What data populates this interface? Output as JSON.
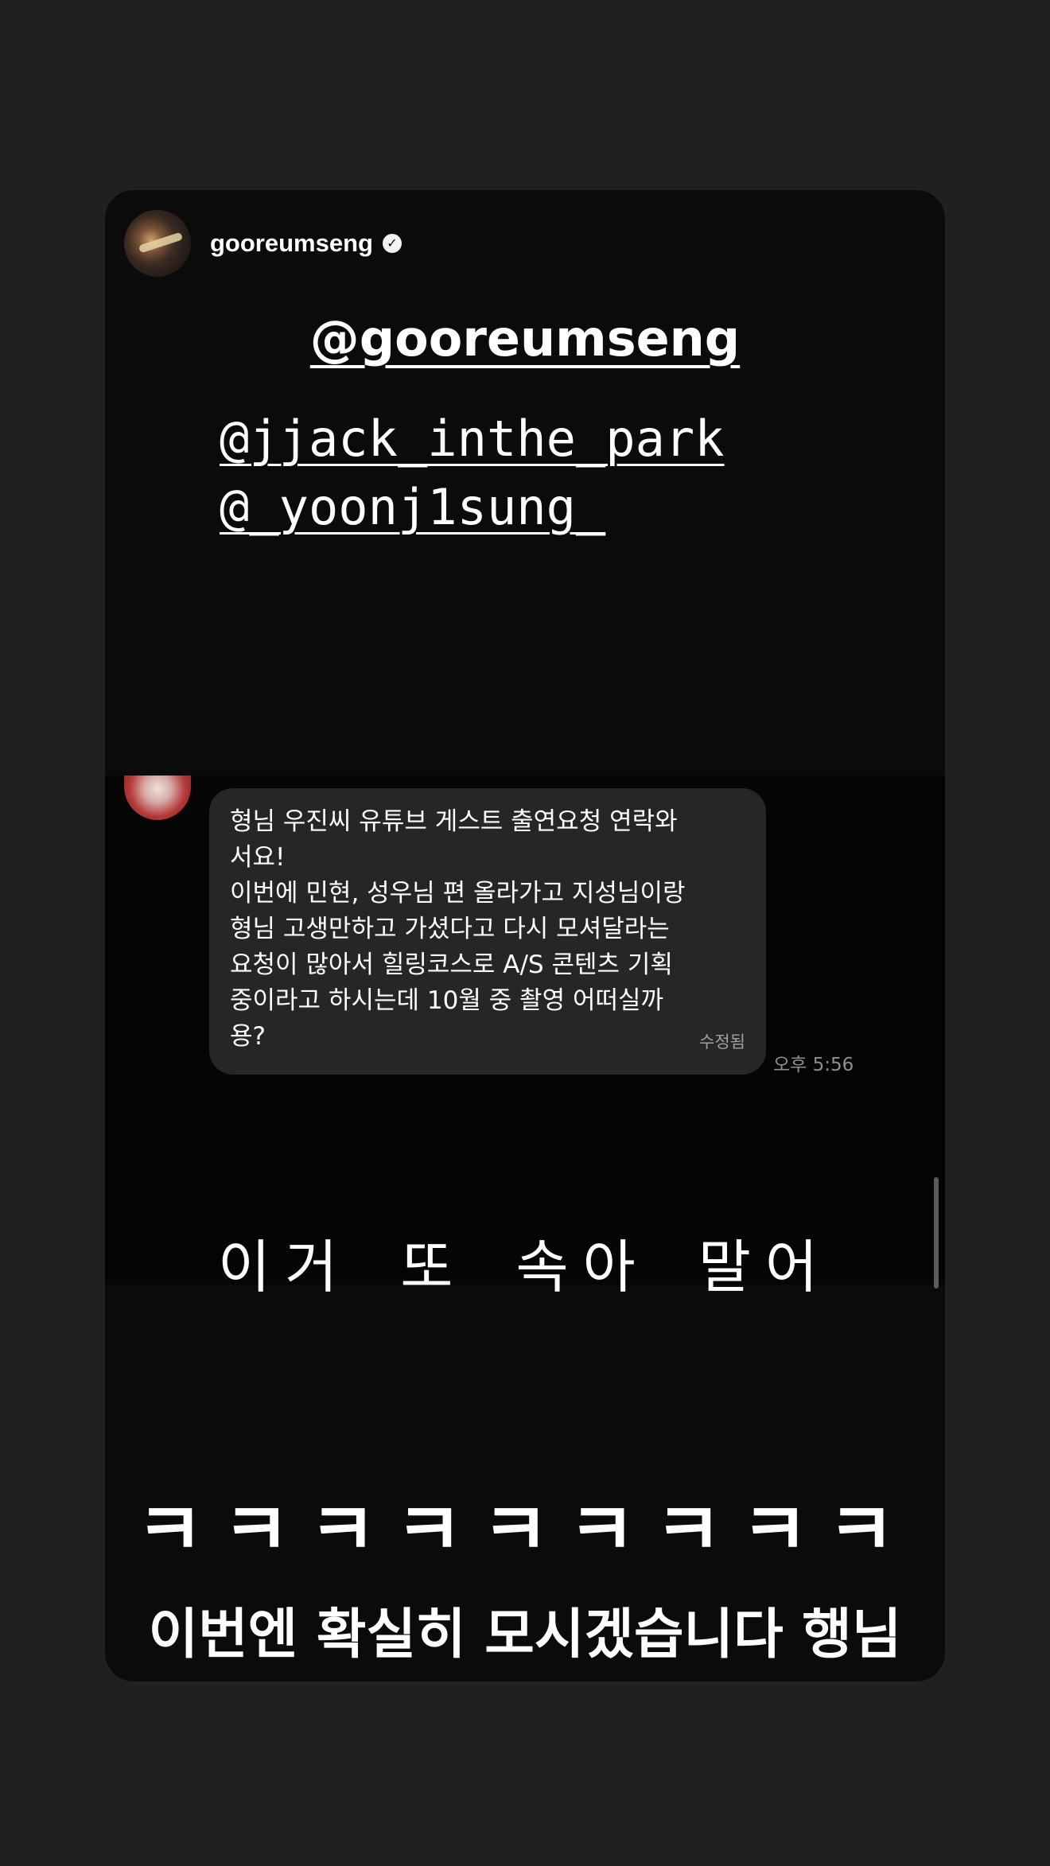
{
  "story": {
    "username": "gooreumseng",
    "verified": true
  },
  "mentions": {
    "main": "@gooreumseng",
    "secondary": [
      "@jjack_inthe_park",
      "@_yoonj1sung_"
    ]
  },
  "dm": {
    "message": "형님 우진씨 유튜브 게스트 출연요청 연락와\n서요!\n이번에 민현, 성우님 편 올라가고 지성님이랑\n형님 고생만하고 가셨다고 다시 모셔달라는\n요청이 많아서 힐링코스로 A/S 콘텐츠 기획\n중이라고 하시는데 10월 중 촬영 어떠실까\n용?",
    "edited_label": "수정됨",
    "timestamp": "오후 5:56"
  },
  "captions": {
    "line1": "이거 또 속아 말어",
    "laugh": "ㅋㅋㅋㅋㅋㅋㅋㅋㅋ",
    "line2": "이번엔 확실히 모시겠습니다 행님"
  },
  "colors": {
    "page_background": "#202020",
    "story_background": "#0b0b0b",
    "bubble_background": "#262626",
    "text": "#ffffff",
    "muted_text": "#8f8f8f"
  }
}
